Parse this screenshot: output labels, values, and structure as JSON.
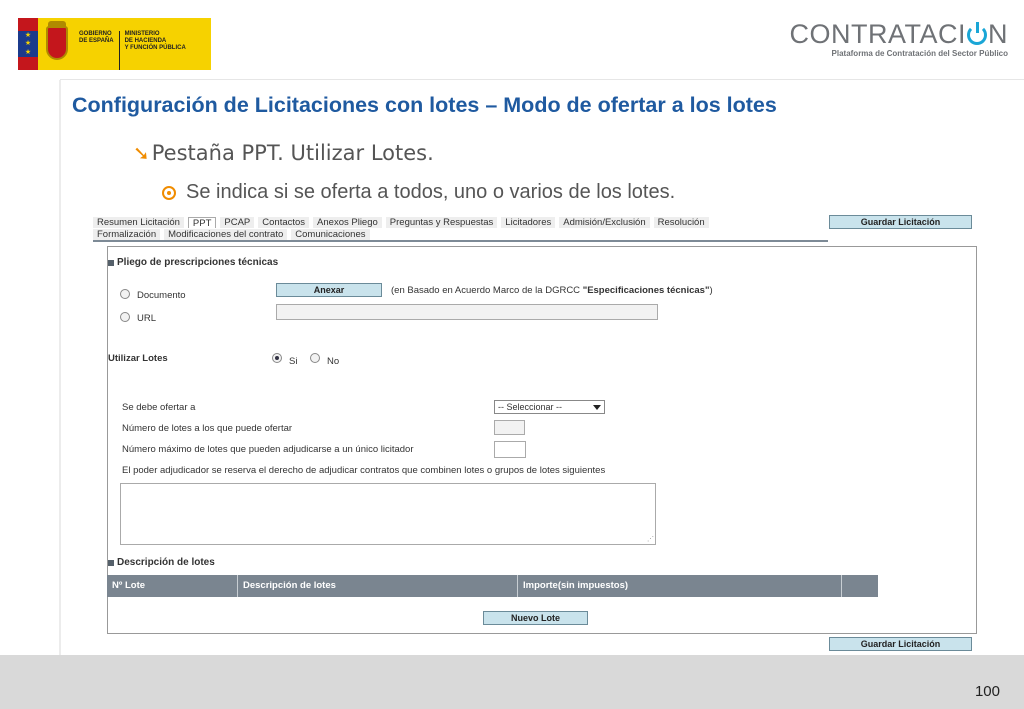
{
  "header": {
    "gov_logo": {
      "line1": "GOBIERNO",
      "line2": "DE ESPAÑA",
      "ministry_line1": "MINISTERIO",
      "ministry_line2": "DE HACIENDA",
      "ministry_line3": "Y FUNCIÓN PÚBLICA"
    },
    "platform": {
      "title_part1": "CONTRATACI",
      "title_part2": "N",
      "subtitle": "Plataforma de Contratación del Sector Público",
      "accent_color": "#1aa6d6"
    }
  },
  "slide": {
    "title": "Configuración de Licitaciones con lotes – Modo de ofertar a los lotes",
    "bullet1": "Pestaña PPT. Utilizar Lotes.",
    "bullet2": "Se indica si se oferta a todos, uno o varios de los lotes.",
    "page_number": "100"
  },
  "app": {
    "tabs_row1": [
      "Resumen Licitación",
      "PPT",
      "PCAP",
      "Contactos",
      "Anexos Pliego",
      "Preguntas y Respuestas",
      "Licitadores",
      "Admisión/Exclusión",
      "Resolución"
    ],
    "tabs_row2": [
      "Formalización",
      "Modificaciones del contrato",
      "Comunicaciones"
    ],
    "active_tab": "PPT",
    "save_label": "Guardar Licitación",
    "pliego": {
      "title": "Pliego de prescripciones técnicas",
      "option_documento": "Documento",
      "option_url": "URL",
      "annex_button": "Anexar",
      "annex_note_prefix": "(en Basado en Acuerdo Marco de la DGRCC ",
      "annex_note_bold": "\"Especificaciones técnicas\"",
      "annex_note_suffix": ")"
    },
    "lotes": {
      "label": "Utilizar Lotes",
      "yes": "Si",
      "no": "No",
      "selected": "Si"
    },
    "fields": {
      "ofertar_label": "Se debe ofertar a",
      "ofertar_value": "-- Seleccionar --",
      "num_lotes_label": "Número de lotes a los que puede ofertar",
      "num_max_label": "Número máximo de lotes que pueden adjudicarse a un único licitador",
      "reserva_label": "El poder adjudicador se reserva el derecho de adjudicar contratos que combinen lotes o grupos de lotes siguientes"
    },
    "descripcion": {
      "title": "Descripción de lotes",
      "columns": [
        "Nº Lote",
        "Descripción de lotes",
        "Importe(sin impuestos)",
        ""
      ],
      "new_button": "Nuevo Lote"
    }
  }
}
